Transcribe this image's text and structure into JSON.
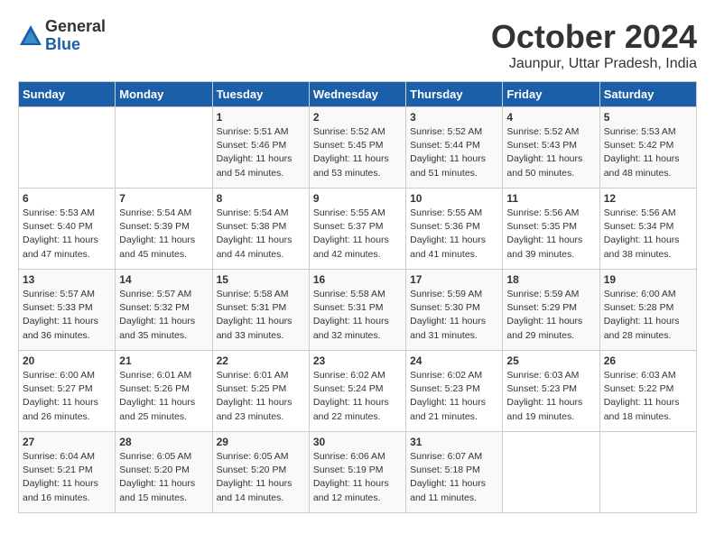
{
  "logo": {
    "general": "General",
    "blue": "Blue"
  },
  "title": "October 2024",
  "location": "Jaunpur, Uttar Pradesh, India",
  "days_header": [
    "Sunday",
    "Monday",
    "Tuesday",
    "Wednesday",
    "Thursday",
    "Friday",
    "Saturday"
  ],
  "weeks": [
    [
      {
        "day": "",
        "sunrise": "",
        "sunset": "",
        "daylight": ""
      },
      {
        "day": "",
        "sunrise": "",
        "sunset": "",
        "daylight": ""
      },
      {
        "day": "1",
        "sunrise": "Sunrise: 5:51 AM",
        "sunset": "Sunset: 5:46 PM",
        "daylight": "Daylight: 11 hours and 54 minutes."
      },
      {
        "day": "2",
        "sunrise": "Sunrise: 5:52 AM",
        "sunset": "Sunset: 5:45 PM",
        "daylight": "Daylight: 11 hours and 53 minutes."
      },
      {
        "day": "3",
        "sunrise": "Sunrise: 5:52 AM",
        "sunset": "Sunset: 5:44 PM",
        "daylight": "Daylight: 11 hours and 51 minutes."
      },
      {
        "day": "4",
        "sunrise": "Sunrise: 5:52 AM",
        "sunset": "Sunset: 5:43 PM",
        "daylight": "Daylight: 11 hours and 50 minutes."
      },
      {
        "day": "5",
        "sunrise": "Sunrise: 5:53 AM",
        "sunset": "Sunset: 5:42 PM",
        "daylight": "Daylight: 11 hours and 48 minutes."
      }
    ],
    [
      {
        "day": "6",
        "sunrise": "Sunrise: 5:53 AM",
        "sunset": "Sunset: 5:40 PM",
        "daylight": "Daylight: 11 hours and 47 minutes."
      },
      {
        "day": "7",
        "sunrise": "Sunrise: 5:54 AM",
        "sunset": "Sunset: 5:39 PM",
        "daylight": "Daylight: 11 hours and 45 minutes."
      },
      {
        "day": "8",
        "sunrise": "Sunrise: 5:54 AM",
        "sunset": "Sunset: 5:38 PM",
        "daylight": "Daylight: 11 hours and 44 minutes."
      },
      {
        "day": "9",
        "sunrise": "Sunrise: 5:55 AM",
        "sunset": "Sunset: 5:37 PM",
        "daylight": "Daylight: 11 hours and 42 minutes."
      },
      {
        "day": "10",
        "sunrise": "Sunrise: 5:55 AM",
        "sunset": "Sunset: 5:36 PM",
        "daylight": "Daylight: 11 hours and 41 minutes."
      },
      {
        "day": "11",
        "sunrise": "Sunrise: 5:56 AM",
        "sunset": "Sunset: 5:35 PM",
        "daylight": "Daylight: 11 hours and 39 minutes."
      },
      {
        "day": "12",
        "sunrise": "Sunrise: 5:56 AM",
        "sunset": "Sunset: 5:34 PM",
        "daylight": "Daylight: 11 hours and 38 minutes."
      }
    ],
    [
      {
        "day": "13",
        "sunrise": "Sunrise: 5:57 AM",
        "sunset": "Sunset: 5:33 PM",
        "daylight": "Daylight: 11 hours and 36 minutes."
      },
      {
        "day": "14",
        "sunrise": "Sunrise: 5:57 AM",
        "sunset": "Sunset: 5:32 PM",
        "daylight": "Daylight: 11 hours and 35 minutes."
      },
      {
        "day": "15",
        "sunrise": "Sunrise: 5:58 AM",
        "sunset": "Sunset: 5:31 PM",
        "daylight": "Daylight: 11 hours and 33 minutes."
      },
      {
        "day": "16",
        "sunrise": "Sunrise: 5:58 AM",
        "sunset": "Sunset: 5:31 PM",
        "daylight": "Daylight: 11 hours and 32 minutes."
      },
      {
        "day": "17",
        "sunrise": "Sunrise: 5:59 AM",
        "sunset": "Sunset: 5:30 PM",
        "daylight": "Daylight: 11 hours and 31 minutes."
      },
      {
        "day": "18",
        "sunrise": "Sunrise: 5:59 AM",
        "sunset": "Sunset: 5:29 PM",
        "daylight": "Daylight: 11 hours and 29 minutes."
      },
      {
        "day": "19",
        "sunrise": "Sunrise: 6:00 AM",
        "sunset": "Sunset: 5:28 PM",
        "daylight": "Daylight: 11 hours and 28 minutes."
      }
    ],
    [
      {
        "day": "20",
        "sunrise": "Sunrise: 6:00 AM",
        "sunset": "Sunset: 5:27 PM",
        "daylight": "Daylight: 11 hours and 26 minutes."
      },
      {
        "day": "21",
        "sunrise": "Sunrise: 6:01 AM",
        "sunset": "Sunset: 5:26 PM",
        "daylight": "Daylight: 11 hours and 25 minutes."
      },
      {
        "day": "22",
        "sunrise": "Sunrise: 6:01 AM",
        "sunset": "Sunset: 5:25 PM",
        "daylight": "Daylight: 11 hours and 23 minutes."
      },
      {
        "day": "23",
        "sunrise": "Sunrise: 6:02 AM",
        "sunset": "Sunset: 5:24 PM",
        "daylight": "Daylight: 11 hours and 22 minutes."
      },
      {
        "day": "24",
        "sunrise": "Sunrise: 6:02 AM",
        "sunset": "Sunset: 5:23 PM",
        "daylight": "Daylight: 11 hours and 21 minutes."
      },
      {
        "day": "25",
        "sunrise": "Sunrise: 6:03 AM",
        "sunset": "Sunset: 5:23 PM",
        "daylight": "Daylight: 11 hours and 19 minutes."
      },
      {
        "day": "26",
        "sunrise": "Sunrise: 6:03 AM",
        "sunset": "Sunset: 5:22 PM",
        "daylight": "Daylight: 11 hours and 18 minutes."
      }
    ],
    [
      {
        "day": "27",
        "sunrise": "Sunrise: 6:04 AM",
        "sunset": "Sunset: 5:21 PM",
        "daylight": "Daylight: 11 hours and 16 minutes."
      },
      {
        "day": "28",
        "sunrise": "Sunrise: 6:05 AM",
        "sunset": "Sunset: 5:20 PM",
        "daylight": "Daylight: 11 hours and 15 minutes."
      },
      {
        "day": "29",
        "sunrise": "Sunrise: 6:05 AM",
        "sunset": "Sunset: 5:20 PM",
        "daylight": "Daylight: 11 hours and 14 minutes."
      },
      {
        "day": "30",
        "sunrise": "Sunrise: 6:06 AM",
        "sunset": "Sunset: 5:19 PM",
        "daylight": "Daylight: 11 hours and 12 minutes."
      },
      {
        "day": "31",
        "sunrise": "Sunrise: 6:07 AM",
        "sunset": "Sunset: 5:18 PM",
        "daylight": "Daylight: 11 hours and 11 minutes."
      },
      {
        "day": "",
        "sunrise": "",
        "sunset": "",
        "daylight": ""
      },
      {
        "day": "",
        "sunrise": "",
        "sunset": "",
        "daylight": ""
      }
    ]
  ]
}
